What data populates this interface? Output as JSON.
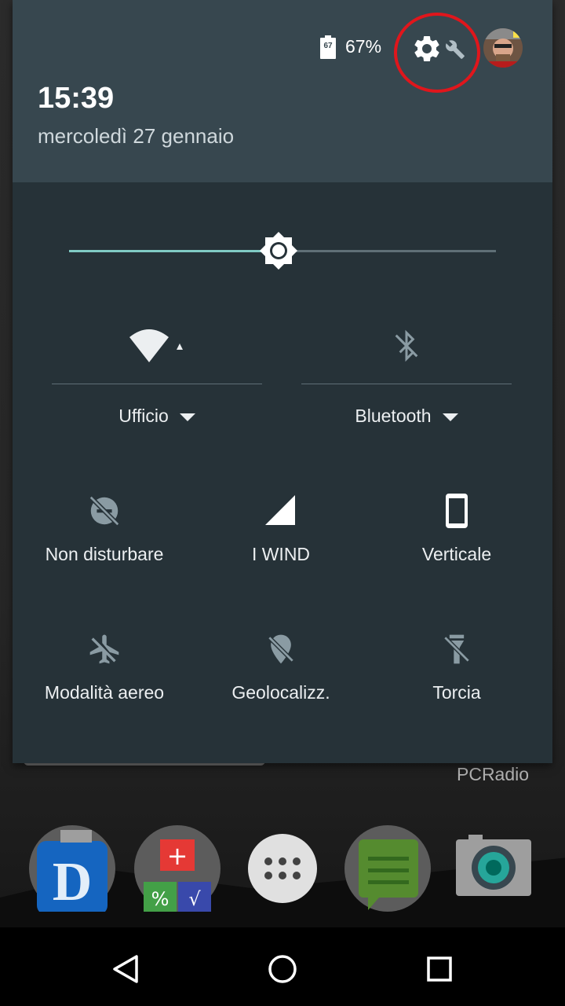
{
  "status": {
    "battery_icon_text": "67",
    "battery_percent": "67%"
  },
  "header": {
    "time": "15:39",
    "date": "mercoledì 27 gennaio"
  },
  "brightness": {
    "level": 0.49
  },
  "big_tiles": [
    {
      "label": "Ufficio",
      "icon": "wifi-icon"
    },
    {
      "label": "Bluetooth",
      "icon": "bluetooth-off-icon"
    }
  ],
  "tiles": [
    {
      "label": "Non disturbare",
      "icon": "do-not-disturb-off-icon"
    },
    {
      "label": "I WIND",
      "icon": "cell-signal-icon"
    },
    {
      "label": "Verticale",
      "icon": "portrait-rotation-icon"
    },
    {
      "label": "Modalità aereo",
      "icon": "airplane-mode-off-icon"
    },
    {
      "label": "Geolocalizz.",
      "icon": "location-off-icon"
    },
    {
      "label": "Torcia",
      "icon": "flashlight-off-icon"
    }
  ],
  "home": {
    "widget_label": "PCRadio",
    "dock": [
      "dlink-app-icon",
      "calculator-app-icon",
      "app-drawer-icon",
      "messaging-app-icon",
      "camera-app-icon"
    ]
  },
  "colors": {
    "header_bg": "#37474f",
    "panel_bg": "#263238",
    "accent": "#80cbc4",
    "highlight": "#e0161c"
  }
}
